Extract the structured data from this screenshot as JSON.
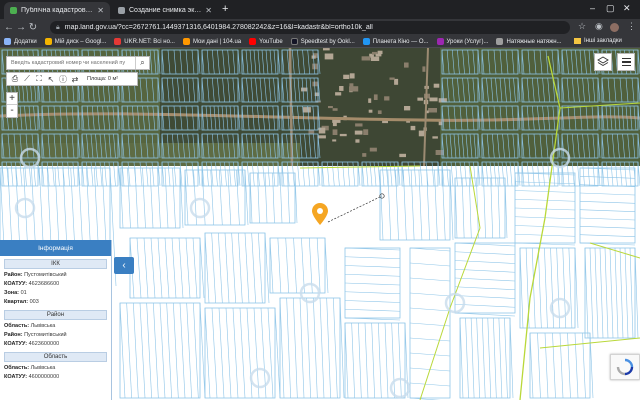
{
  "browser": {
    "tabs": [
      {
        "title": "Публічна кадастрова карта У",
        "icon": "map-favicon",
        "active": true
      },
      {
        "title": "Создание снимка экрана на",
        "icon": "page-favicon",
        "active": false
      }
    ],
    "new_tab": "+",
    "url_host": "map.land.gov.ua",
    "url_rest": "/?cc=2672761.144937131",
    "url_value": "map.land.gov.ua/?cc=2672761.1449371316,6401984.278082242&z=16&l=kadastr&bl=ortho10k_all",
    "bookmarks": [
      {
        "label": "Додатки",
        "icon": "apps-icon",
        "color": "#8ab4f8"
      },
      {
        "label": "Мій диск – Googl...",
        "icon": "drive-icon",
        "color": "#f4b400"
      },
      {
        "label": "UKR.NET: Всі но...",
        "icon": "ukrnet-icon",
        "color": "#e53935"
      },
      {
        "label": "Мои дані | 104.ua",
        "icon": "gas-icon",
        "color": "#ff9800"
      },
      {
        "label": "YouTube",
        "icon": "youtube-icon",
        "color": "#ff0000"
      },
      {
        "label": "Speedtest by Ookl...",
        "icon": "speedtest-icon",
        "color": "#141526"
      },
      {
        "label": "Планета Кіно — О...",
        "icon": "cinema-icon",
        "color": "#2196f3"
      },
      {
        "label": "Уроки (Услуг)...",
        "icon": "lessons-icon",
        "color": "#9c27b0"
      },
      {
        "label": "Натяжные натяжн...",
        "icon": "page-icon",
        "color": "#9e9e9e"
      }
    ],
    "other_bookmarks": "Інші закладки"
  },
  "map": {
    "search_placeholder": "Введіть кадастровий номер чи населений пу",
    "area_label": "Площа: 0 м²",
    "zoom_in": "+",
    "zoom_out": "-"
  },
  "info_panel": {
    "title": "Інформація",
    "sections": [
      {
        "heading": "ІКК",
        "rows": [
          {
            "key": "Район:",
            "value": "Пустомитівський"
          },
          {
            "key": "КОАТУУ:",
            "value": "4623686600"
          },
          {
            "key": "Зона:",
            "value": "01"
          },
          {
            "key": "Квартал:",
            "value": "003"
          }
        ]
      },
      {
        "heading": "Район",
        "rows": [
          {
            "key": "Область:",
            "value": "Львівська"
          },
          {
            "key": "Район:",
            "value": "Пустомитівський"
          },
          {
            "key": "КОАТУУ:",
            "value": "4623600000"
          }
        ]
      },
      {
        "heading": "Область",
        "rows": [
          {
            "key": "Область:",
            "value": "Львівська"
          },
          {
            "key": "КОАТУУ:",
            "value": "4600000000"
          }
        ]
      }
    ],
    "collapse_label": "‹"
  },
  "colors": {
    "accent": "#3a7fc2",
    "parcel": "#8ec5e8",
    "boundary": "#c6e34a",
    "pin": "#f5a623",
    "chrome": "#35363a"
  }
}
